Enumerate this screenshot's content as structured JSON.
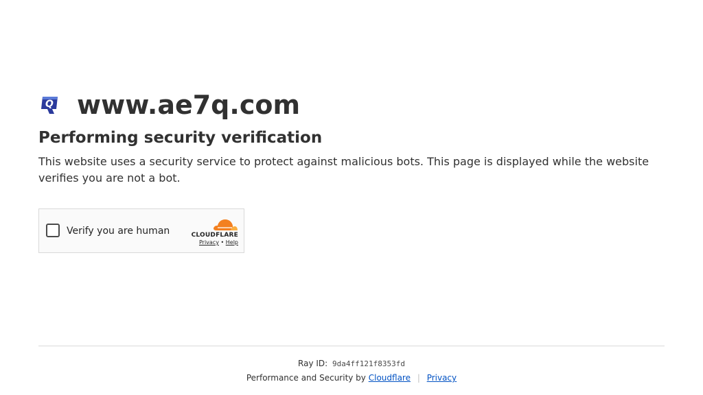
{
  "site": {
    "name": "www.ae7q.com",
    "favicon_icon": "ae7q-q-logo-icon",
    "favicon_letter": "Q"
  },
  "heading": "Performing security verification",
  "description": "This website uses a security service to protect against malicious bots. This page is displayed while the website verifies you are not a bot.",
  "widget": {
    "label": "Verify you are human",
    "brand": "CLOUDFLARE",
    "privacy_link": "Privacy",
    "link_separator": "•",
    "help_link": "Help",
    "cloud_icon": "cloudflare-cloud-icon"
  },
  "footer": {
    "ray_label": "Ray ID:",
    "ray_id": "9da4ff121f8353fd",
    "performance_text": "Performance and Security by",
    "cloudflare_link": "Cloudflare",
    "separator": "|",
    "privacy_link": "Privacy"
  },
  "colors": {
    "text": "#313131",
    "link": "#0051c3",
    "cloudflare_orange": "#f38020",
    "cloudflare_light_orange": "#faae40",
    "favicon_blue": "#2b3a9c"
  }
}
